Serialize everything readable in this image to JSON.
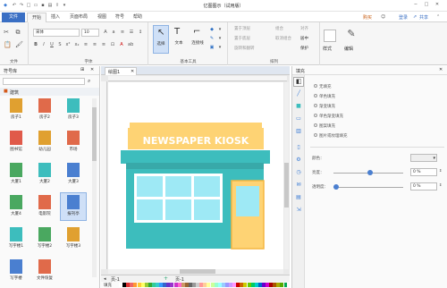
{
  "window": {
    "title": "亿图图示（试用版）"
  },
  "title_right": {
    "buy": "购买",
    "login": "登录",
    "share": "共享"
  },
  "tabs": [
    "文件",
    "开始",
    "插入",
    "页面布局",
    "视图",
    "符号",
    "帮助"
  ],
  "ribbon": {
    "font_name": "宋体",
    "font_size": "10",
    "group_labels": [
      "文件",
      "字体",
      "基本工具",
      "排列"
    ],
    "tools": {
      "select": "选择",
      "text": "文本",
      "connector": "连接线"
    },
    "arrange_items": [
      "置于顶层",
      "组合",
      "对齐",
      "置于底层",
      "取消组合",
      "居中",
      "旋转和翻转",
      "保护"
    ],
    "style": "样式",
    "edit": "编辑"
  },
  "left_panel": {
    "title": "符号库",
    "category": "建筑",
    "symbols": [
      "房子1",
      "房子2",
      "房子3",
      "图书馆",
      "幼儿园",
      "市场",
      "大厦1",
      "大厦2",
      "大厦3",
      "大厦4",
      "电影院",
      "报刊亭",
      "写字楼1",
      "写字楼2",
      "写字楼3",
      "写字楼",
      "文件恢复"
    ]
  },
  "document_tab": "绘图1",
  "canvas": {
    "sign_text": "NEWSPAPER KIOSK"
  },
  "page_tab": {
    "left": "页-1",
    "right": "页-1"
  },
  "fill_label": "填充",
  "right_panel": {
    "title": "填充",
    "options": [
      "无填充",
      "单色填充",
      "渐变填充",
      "单色渐变填充",
      "图案填充",
      "图片或纹理填充"
    ],
    "color_label": "颜色：",
    "brightness_label": "亮度：",
    "brightness_value": "0 %",
    "transparency_label": "透明度：",
    "transparency_value": "0 %"
  },
  "colors": {
    "teal": "#3dbdbd",
    "yellow": "#fed374",
    "window": "#9ee9f5",
    "accent": "#4a7fd0"
  }
}
